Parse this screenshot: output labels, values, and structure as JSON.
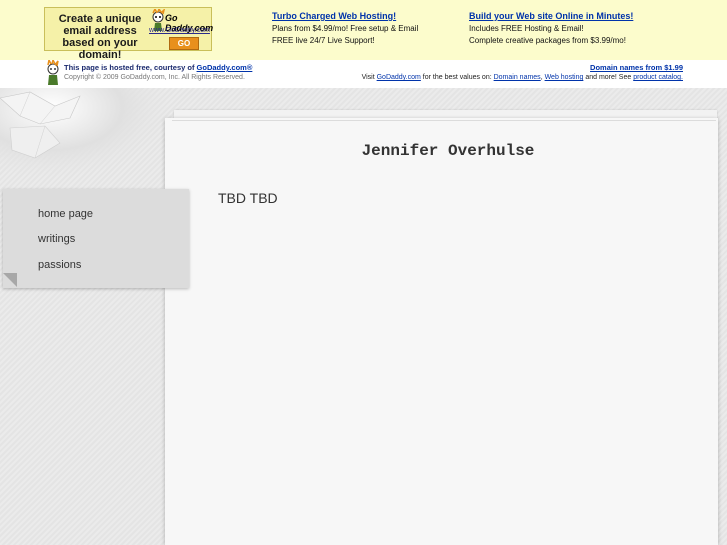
{
  "ad_top": {
    "image_ad": {
      "headline": "Create a unique email address based on your domain!",
      "logo_text": "Go Daddy.com",
      "logo_url": "www.GoDaddy.com",
      "go_label": "GO"
    },
    "ad1": {
      "title": "Turbo Charged Web Hosting!",
      "line1": "Plans from $4.99/mo! Free setup & Email",
      "line2": "FREE live 24/7 Live Support!"
    },
    "ad2": {
      "title": "Build your Web site Online in Minutes!",
      "line1": "Includes FREE Hosting & Email!",
      "line2": "Complete creative packages from $3.99/mo!"
    }
  },
  "hosted": {
    "prefix": "This page is hosted free, courtesy of ",
    "link": "GoDaddy.com®",
    "copyright": "Copyright © 2009 GoDaddy.com, Inc. All Rights Reserved.",
    "right_link": "Domain names from $1.99",
    "visit_prefix": "Visit ",
    "visit_link": "GoDaddy.com",
    "visit_mid": " for the best values on: ",
    "link_domains": "Domain names",
    "comma": ", ",
    "link_hosting": "Web hosting",
    "visit_suffix": " and more! See ",
    "link_catalog": "product catalog."
  },
  "site": {
    "title": "Jennifer Overhulse",
    "content": "TBD TBD"
  },
  "nav": {
    "items": [
      {
        "label": "home page"
      },
      {
        "label": "writings"
      },
      {
        "label": "passions"
      }
    ]
  },
  "colors": {
    "ad_background": "#fcfccc",
    "link_blue": "#0033aa",
    "page_background": "#e6e6e6",
    "paper": "#f7f7f7"
  }
}
